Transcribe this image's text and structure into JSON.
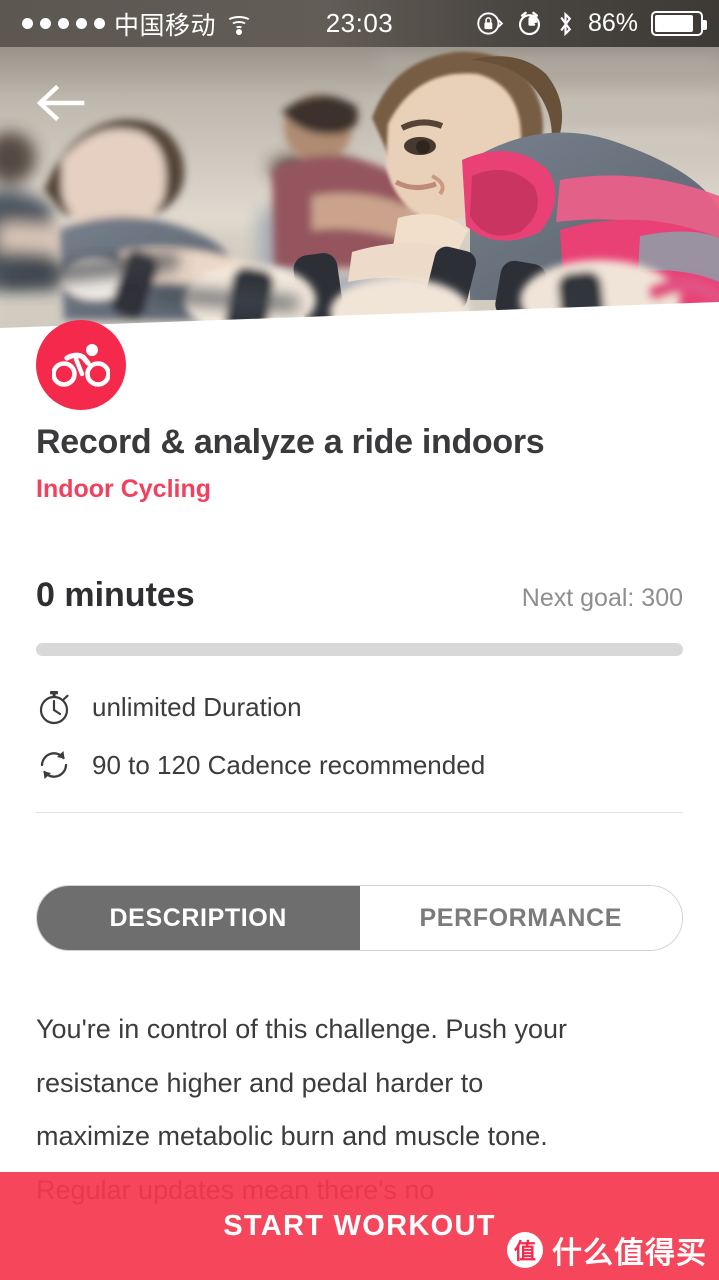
{
  "status_bar": {
    "signal_dots": 5,
    "carrier": "中国移动",
    "wifi_icon": "wifi-icon",
    "time": "23:03",
    "rotation_lock_icon": "rotation-lock-icon",
    "alarm_icon": "alarm-clock-icon",
    "bluetooth_icon": "bluetooth-icon",
    "battery_percent": "86%",
    "battery_level": 86
  },
  "hero": {
    "back_icon": "back-arrow-icon",
    "activity_badge_icon": "cycling-icon",
    "image_alt": "indoor cycling spin class"
  },
  "workout": {
    "title": "Record & analyze a ride indoors",
    "category": "Indoor Cycling",
    "progress_value": "0 minutes",
    "progress_percent": 0,
    "next_goal": "Next goal: 300",
    "details": [
      {
        "icon": "stopwatch-icon",
        "text": "unlimited Duration"
      },
      {
        "icon": "cadence-refresh-icon",
        "text": "90 to 120 Cadence recommended"
      }
    ]
  },
  "tabs": [
    {
      "label": "DESCRIPTION",
      "active": true
    },
    {
      "label": "PERFORMANCE",
      "active": false
    }
  ],
  "description": {
    "line1": "You're in control of this challenge. Push your",
    "line2": "resistance higher and pedal harder to",
    "line3": "maximize metabolic burn and muscle tone.",
    "line4": "Regular updates mean there's no"
  },
  "cta": {
    "label": "START WORKOUT"
  },
  "watermark": {
    "mark": "值",
    "text": "什么值得买"
  },
  "colors": {
    "accent_red": "#f4294c",
    "cta_red": "#f43850",
    "title_gray": "#3a3a3c",
    "muted_gray": "#8e8e90",
    "tab_active_bg": "#6e6e6e"
  }
}
